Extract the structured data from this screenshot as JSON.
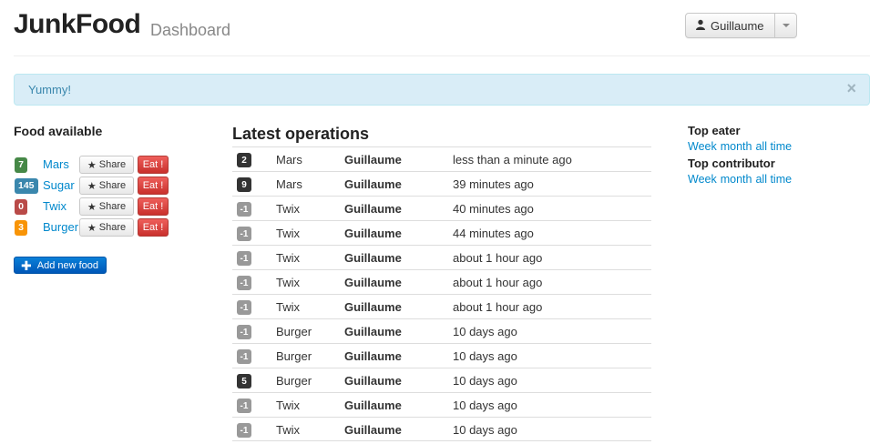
{
  "header": {
    "brand": "JunkFood",
    "subtitle": "Dashboard",
    "user_label": "Guillaume"
  },
  "alert": {
    "message": "Yummy!",
    "close": "×"
  },
  "food": {
    "heading": "Food available",
    "share_label": "Share",
    "eat_label": "Eat !",
    "add_label": "Add new food",
    "items": [
      {
        "count": "7",
        "name": "Mars",
        "color": "#468847"
      },
      {
        "count": "145",
        "name": "Sugar",
        "color": "#3a87ad"
      },
      {
        "count": "0",
        "name": "Twix",
        "color": "#b94a48"
      },
      {
        "count": "3",
        "name": "Burger",
        "color": "#f89406"
      }
    ]
  },
  "operations": {
    "heading": "Latest operations",
    "rows": [
      {
        "badge": "2",
        "food": "Mars",
        "user": "Guillaume",
        "time": "less than a minute ago",
        "badge_color": "#333333"
      },
      {
        "badge": "9",
        "food": "Mars",
        "user": "Guillaume",
        "time": "39 minutes ago",
        "badge_color": "#333333"
      },
      {
        "badge": "-1",
        "food": "Twix",
        "user": "Guillaume",
        "time": "40 minutes ago",
        "badge_color": "#999999"
      },
      {
        "badge": "-1",
        "food": "Twix",
        "user": "Guillaume",
        "time": "44 minutes ago",
        "badge_color": "#999999"
      },
      {
        "badge": "-1",
        "food": "Twix",
        "user": "Guillaume",
        "time": "about 1 hour ago",
        "badge_color": "#999999"
      },
      {
        "badge": "-1",
        "food": "Twix",
        "user": "Guillaume",
        "time": "about 1 hour ago",
        "badge_color": "#999999"
      },
      {
        "badge": "-1",
        "food": "Twix",
        "user": "Guillaume",
        "time": "about 1 hour ago",
        "badge_color": "#999999"
      },
      {
        "badge": "-1",
        "food": "Burger",
        "user": "Guillaume",
        "time": "10 days ago",
        "badge_color": "#999999"
      },
      {
        "badge": "-1",
        "food": "Burger",
        "user": "Guillaume",
        "time": "10 days ago",
        "badge_color": "#999999"
      },
      {
        "badge": "5",
        "food": "Burger",
        "user": "Guillaume",
        "time": "10 days ago",
        "badge_color": "#333333"
      },
      {
        "badge": "-1",
        "food": "Twix",
        "user": "Guillaume",
        "time": "10 days ago",
        "badge_color": "#999999"
      },
      {
        "badge": "-1",
        "food": "Twix",
        "user": "Guillaume",
        "time": "10 days ago",
        "badge_color": "#999999"
      }
    ]
  },
  "sidebar": {
    "top_eater": {
      "heading": "Top eater",
      "links": [
        "Week",
        "month",
        "all time"
      ]
    },
    "top_contributor": {
      "heading": "Top contributor",
      "links": [
        "Week",
        "month",
        "all time"
      ]
    }
  }
}
